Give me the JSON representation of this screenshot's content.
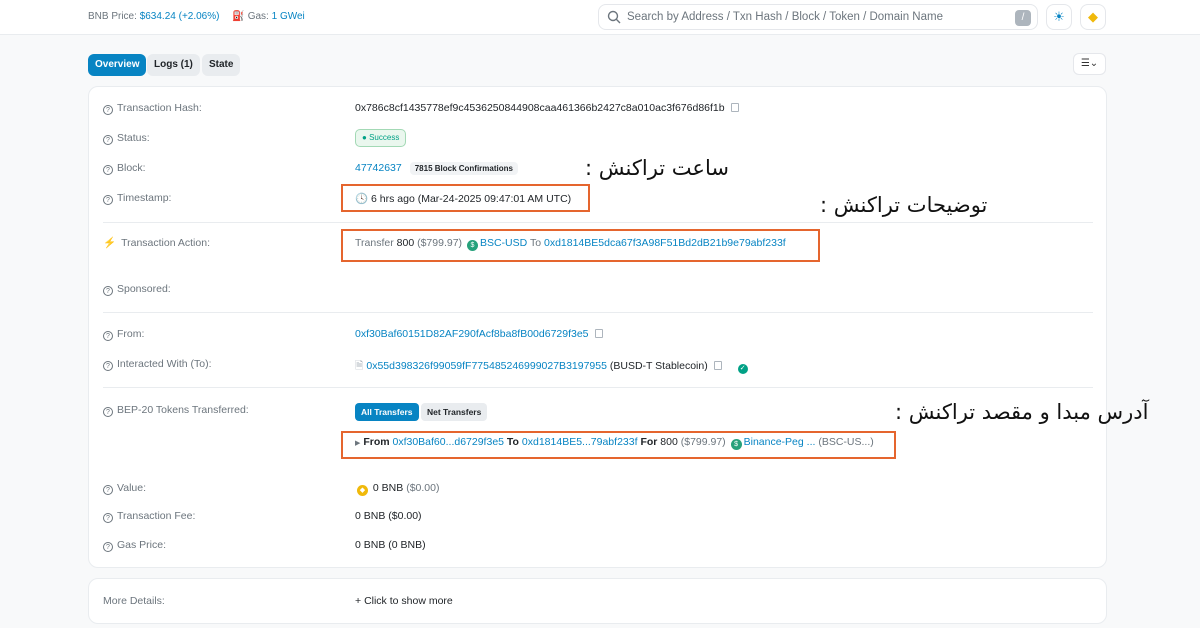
{
  "topbar": {
    "bnb_price_label": "BNB Price:",
    "bnb_price_value": "$634.24 (+2.06%)",
    "gas_label": "Gas:",
    "gas_value": "1 GWei",
    "search_placeholder": "Search by Address / Txn Hash / Block / Token / Domain Name",
    "search_shortcut": "/"
  },
  "tabs": [
    {
      "label": "Overview",
      "active": true
    },
    {
      "label": "Logs (1)",
      "active": false
    },
    {
      "label": "State",
      "active": false
    }
  ],
  "fields": {
    "tx_hash": {
      "label": "Transaction Hash:",
      "value": "0x786c8cf1435778ef9c4536250844908caa461366b2427c8a010ac3f676d86f1b"
    },
    "status": {
      "label": "Status:",
      "value": "Success"
    },
    "block": {
      "label": "Block:",
      "value": "47742637",
      "confirmations": "7815 Block Confirmations"
    },
    "timestamp": {
      "label": "Timestamp:",
      "value": "6 hrs ago (Mar-24-2025 09:47:01 AM UTC)"
    },
    "action": {
      "label": "Transaction Action:",
      "prefix": "Transfer",
      "amount": "800",
      "usd": "($799.97)",
      "token": "BSC-USD",
      "to_word": "To",
      "to_address": "0xd1814BE5dca67f3A98F51Bd2dB21b9e79abf233f"
    },
    "sponsored": {
      "label": "Sponsored:"
    },
    "from": {
      "label": "From:",
      "value": "0xf30Baf60151D82AF290fAcf8ba8fB00d6729f3e5"
    },
    "interacted": {
      "label": "Interacted With (To):",
      "address": "0x55d398326f99059fF775485246999027B3197955",
      "name": "(BUSD-T Stablecoin)"
    },
    "tokens": {
      "label": "BEP-20 Tokens Transferred:",
      "all_label": "All Transfers",
      "net_label": "Net Transfers",
      "from_word": "From",
      "from_addr": "0xf30Baf60...d6729f3e5",
      "to_word": "To",
      "to_addr": "0xd1814BE5...79abf233f",
      "for_word": "For",
      "amount": "800",
      "usd": "($799.97)",
      "token": "Binance-Peg ...",
      "symbol": "(BSC-US...)"
    },
    "value": {
      "label": "Value:",
      "value": "0 BNB",
      "usd": "($0.00)"
    },
    "fee": {
      "label": "Transaction Fee:",
      "value": "0 BNB ($0.00)"
    },
    "gas_price": {
      "label": "Gas Price:",
      "value": "0 BNB (0 BNB)"
    },
    "more": {
      "label": "More Details:",
      "link": "Click to show more"
    }
  },
  "annotations": {
    "time": "ساعت تراکنش :",
    "desc": "توضیحات تراکنش :",
    "addr": "آدرس مبدا و مقصد تراکنش :"
  },
  "colors": {
    "link": "#0784c3",
    "highlight_box": "#e5652e",
    "success": "#00a186"
  }
}
